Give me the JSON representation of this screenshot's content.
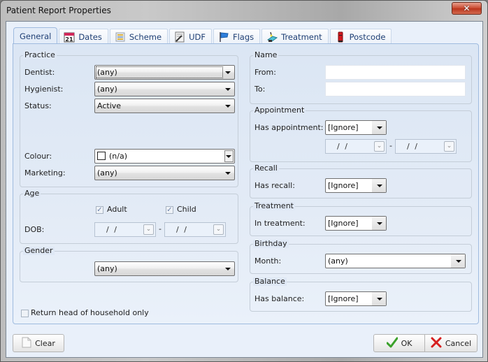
{
  "window": {
    "title": "Patient Report Properties",
    "close_glyph": "✕"
  },
  "tabs": [
    {
      "label": "General",
      "icon": "none",
      "active": true
    },
    {
      "label": "Dates",
      "icon": "calendar-icon",
      "calendar_day": "21",
      "active": false
    },
    {
      "label": "Scheme",
      "icon": "scheme-icon",
      "active": false
    },
    {
      "label": "UDF",
      "icon": "udf-icon",
      "active": false
    },
    {
      "label": "Flags",
      "icon": "flag-icon",
      "active": false
    },
    {
      "label": "Treatment",
      "icon": "dental-chair-icon",
      "active": false
    },
    {
      "label": "Postcode",
      "icon": "postbox-icon",
      "active": false
    }
  ],
  "practice": {
    "title": "Practice",
    "dentist_label": "Dentist:",
    "dentist_value": "(any)",
    "hygienist_label": "Hygienist:",
    "hygienist_value": "(any)",
    "status_label": "Status:",
    "status_value": "Active",
    "colour_label": "Colour:",
    "colour_value": "(n/a)",
    "marketing_label": "Marketing:",
    "marketing_value": "(any)"
  },
  "age": {
    "title": "Age",
    "adult_label": "Adult",
    "adult_checked": true,
    "child_label": "Child",
    "child_checked": true,
    "dob_label": "DOB:",
    "dob_from": "/ /",
    "dob_to": "/ /",
    "separator": "-"
  },
  "gender": {
    "title": "Gender",
    "value": "(any)"
  },
  "head_of_household": {
    "label": "Return head of household only",
    "checked": false
  },
  "name": {
    "title": "Name",
    "from_label": "From:",
    "from_value": "",
    "to_label": "To:",
    "to_value": ""
  },
  "appointment": {
    "title": "Appointment",
    "has_label": "Has appointment:",
    "has_value": "[Ignore]",
    "date_from": "/ /",
    "date_to": "/ /",
    "separator": "-"
  },
  "recall": {
    "title": "Recall",
    "has_label": "Has recall:",
    "has_value": "[Ignore]"
  },
  "treatment": {
    "title": "Treatment",
    "in_label": "In treatment:",
    "in_value": "[Ignore]"
  },
  "birthday": {
    "title": "Birthday",
    "month_label": "Month:",
    "month_value": "(any)"
  },
  "balance": {
    "title": "Balance",
    "has_label": "Has balance:",
    "has_value": "[Ignore]"
  },
  "buttons": {
    "clear": "Clear",
    "ok": "OK",
    "cancel": "Cancel"
  },
  "colors": {
    "accent_blue": "#1f3f74",
    "ok_green": "#3aa12a",
    "cancel_red": "#d61f1f",
    "close_red": "#c8462c"
  }
}
